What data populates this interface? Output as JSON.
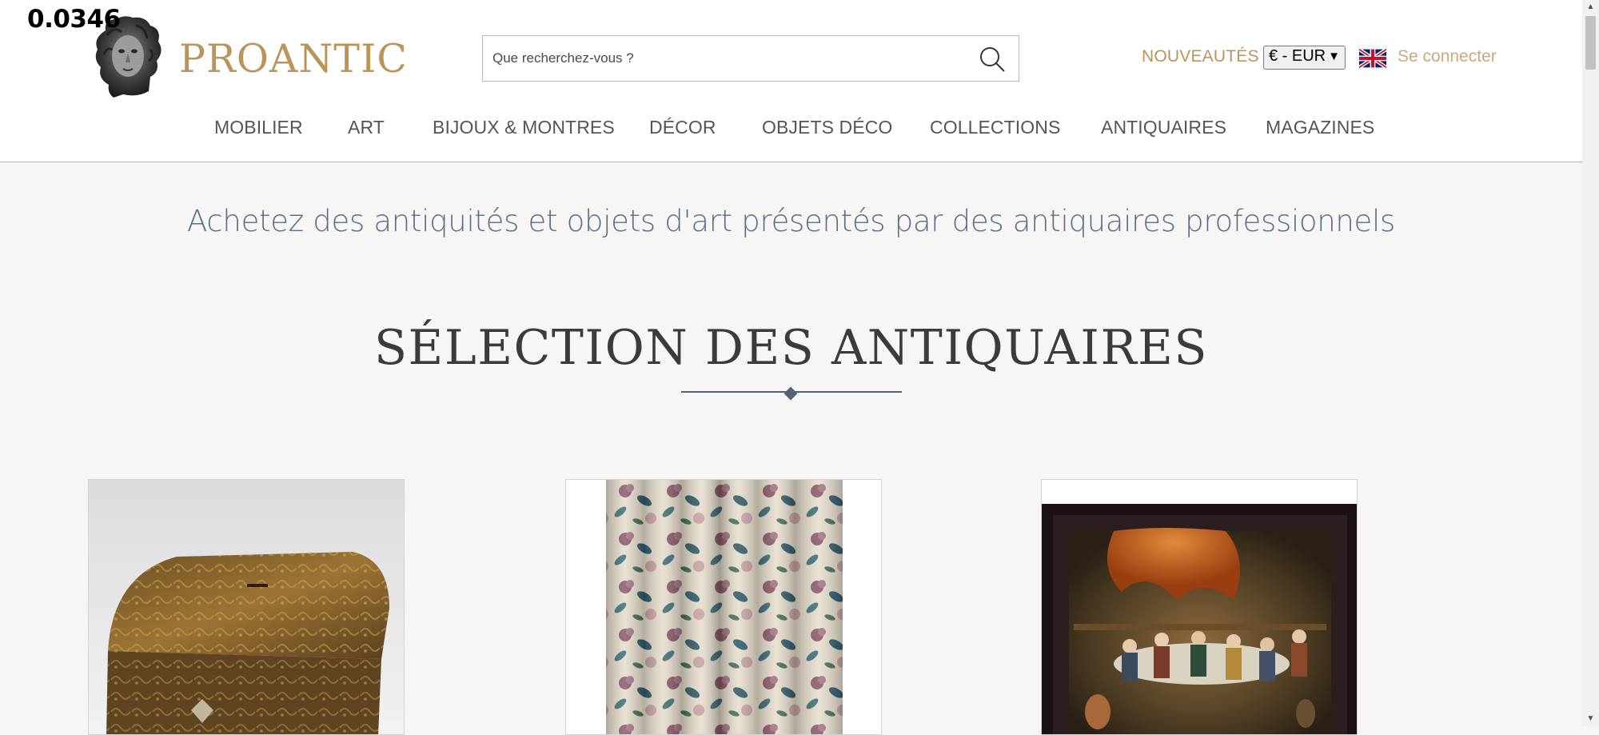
{
  "overlay_value": "0.0346",
  "header": {
    "brand": "PROANTIC",
    "search": {
      "placeholder": "Que recherchez-vous ?",
      "value": ""
    },
    "new_label": "NOUVEAUTÉS",
    "currency": "€ - EUR",
    "login_label": "Se connecter"
  },
  "nav": {
    "items": [
      {
        "label": "MOBILIER"
      },
      {
        "label": "ART"
      },
      {
        "label": "BIJOUX & MONTRES"
      },
      {
        "label": "DÉCOR"
      },
      {
        "label": "OBJETS DÉCO"
      },
      {
        "label": "COLLECTIONS"
      },
      {
        "label": "ANTIQUAIRES"
      },
      {
        "label": "MAGAZINES"
      }
    ]
  },
  "main": {
    "tagline": "Achetez des antiquités et objets d'art présentés par des antiquaires professionnels",
    "section_title": "SÉLECTION DES ANTIQUAIRES"
  },
  "colors": {
    "brand_gold": "#b9945b",
    "tagline_blue": "#5a6e87",
    "page_background": "#f7f6f4"
  }
}
